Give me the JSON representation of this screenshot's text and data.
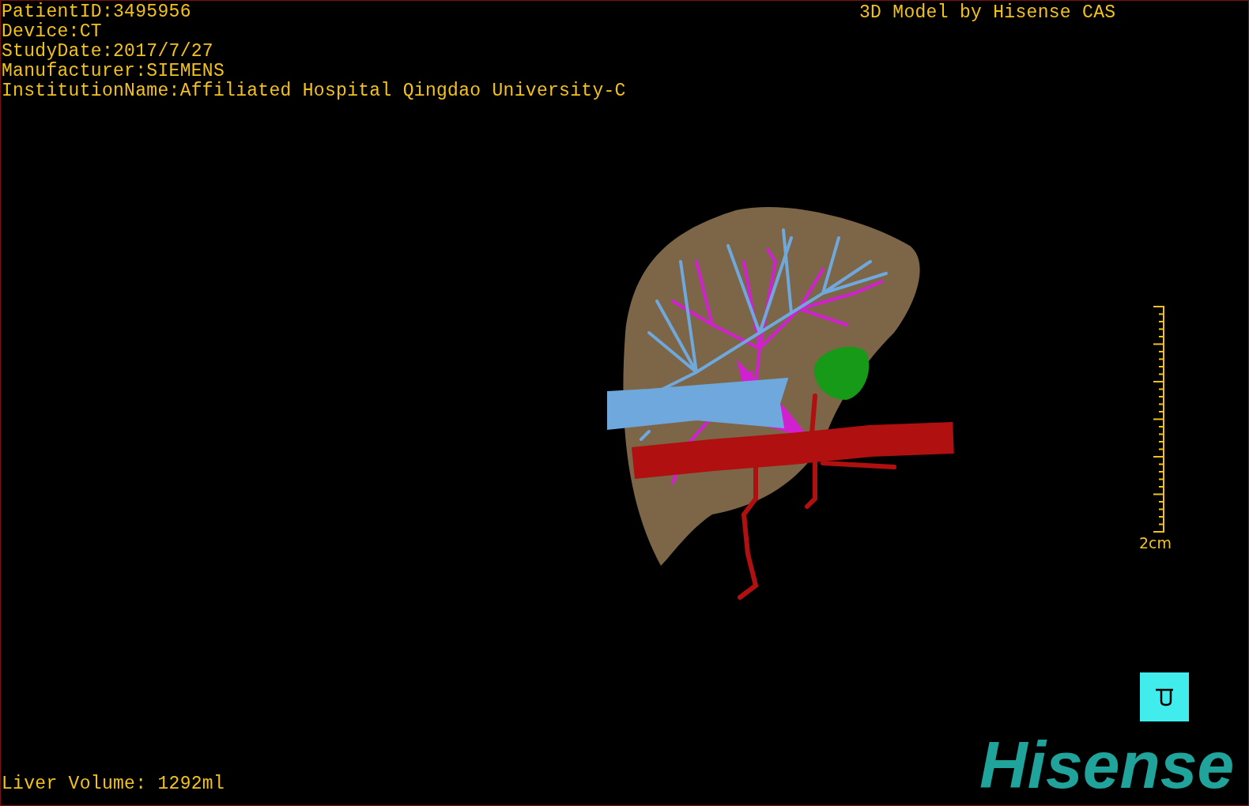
{
  "patient_info": [
    "PatientID:3495956",
    "Device:CT",
    "StudyDate:2017/7/27",
    "Manufacturer:SIEMENS",
    "InstitutionName:Affiliated Hospital Qingdao University-C"
  ],
  "title": "3D Model by Hisense CAS",
  "scale_bar": {
    "label": "2cm"
  },
  "liver_volume": "Liver Volume: 1292ml",
  "logo": "Hisense"
}
